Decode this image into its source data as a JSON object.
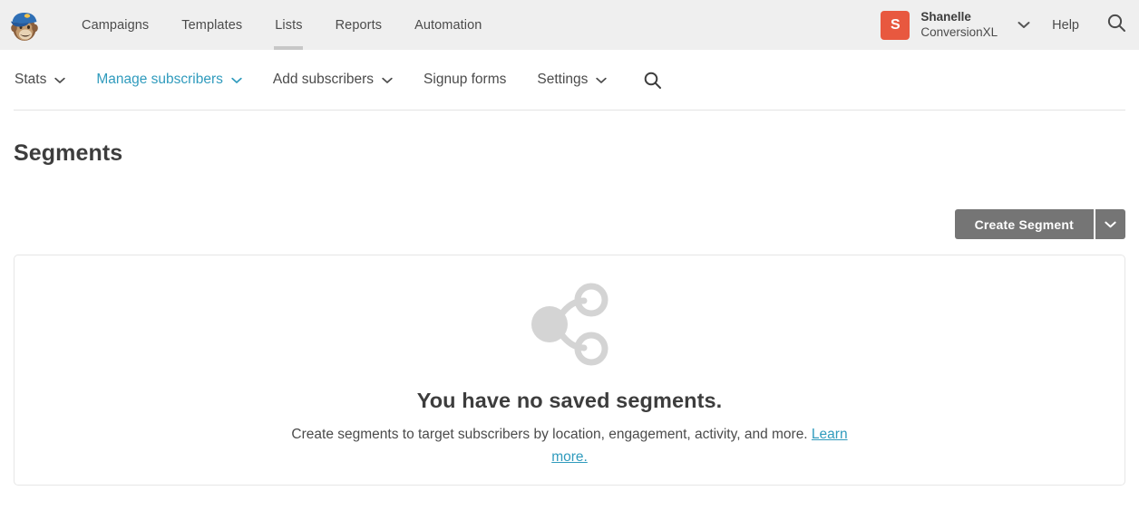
{
  "header": {
    "logo_icon": "mailchimp-freddie-logo",
    "nav": [
      {
        "label": "Campaigns",
        "active": false
      },
      {
        "label": "Templates",
        "active": false
      },
      {
        "label": "Lists",
        "active": true
      },
      {
        "label": "Reports",
        "active": false
      },
      {
        "label": "Automation",
        "active": false
      }
    ],
    "account": {
      "avatar_initial": "S",
      "avatar_color": "#e8583f",
      "name": "Shanelle",
      "org": "ConversionXL",
      "caret_icon": "chevron-down-icon"
    },
    "help_label": "Help",
    "search_icon": "search-icon",
    "background": "#efefef"
  },
  "subnav": {
    "items": [
      {
        "label": "Stats",
        "has_caret": true,
        "active": false
      },
      {
        "label": "Manage subscribers",
        "has_caret": true,
        "active": true
      },
      {
        "label": "Add subscribers",
        "has_caret": true,
        "active": false
      },
      {
        "label": "Signup forms",
        "has_caret": false,
        "active": false
      },
      {
        "label": "Settings",
        "has_caret": true,
        "active": false
      }
    ],
    "search_icon": "search-icon",
    "caret_glyph": "⌄",
    "active_color": "#309bbd"
  },
  "page": {
    "title": "Segments"
  },
  "toolbar": {
    "create_label": "Create Segment",
    "dropdown_icon": "chevron-down-icon",
    "button_color": "#757575"
  },
  "empty_state": {
    "illustration_icon": "segment-share-icon",
    "title": "You have no saved segments.",
    "description_before": "Create segments to target subscribers by location, engagement, activity, and more. ",
    "link_text": "Learn more.",
    "link_color": "#309bbd"
  }
}
